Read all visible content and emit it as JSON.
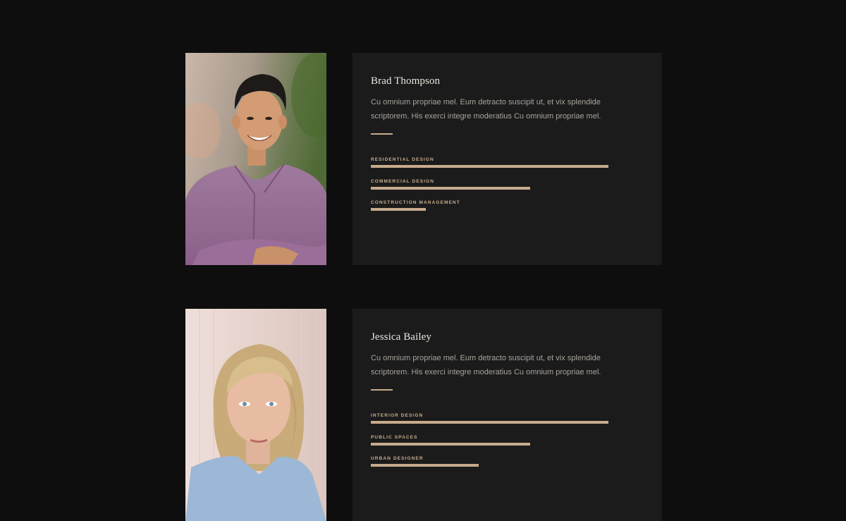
{
  "team": [
    {
      "name": "Brad Thompson",
      "bio": "Cu omnium propriae mel. Eum detracto suscipit ut, et vix splendide scriptorem. His exerci integre moderatius Cu omnium propriae mel.",
      "skills": [
        {
          "label": "RESIDENTIAL DESIGN",
          "level": 0.99
        },
        {
          "label": "COMMERCIAL DESIGN",
          "level": 0.665
        },
        {
          "label": "CONSTRUCTION MANAGEMENT",
          "level": 0.23
        }
      ]
    },
    {
      "name": "Jessica Bailey",
      "bio": "Cu omnium propriae mel. Eum detracto suscipit ut, et vix splendide scriptorem. His exerci integre moderatius Cu omnium propriae mel.",
      "skills": [
        {
          "label": "INTERIOR DESIGN",
          "level": 0.99
        },
        {
          "label": "PUBLIC SPACES",
          "level": 0.665
        },
        {
          "label": "URBAN DESIGNER",
          "level": 0.45
        }
      ]
    }
  ],
  "colors": {
    "page_background": "#0e0e0e",
    "card_background": "#1b1b1b",
    "accent": "#c7ab8c",
    "name_text": "#ebe6df",
    "body_text": "#a9a49d"
  }
}
